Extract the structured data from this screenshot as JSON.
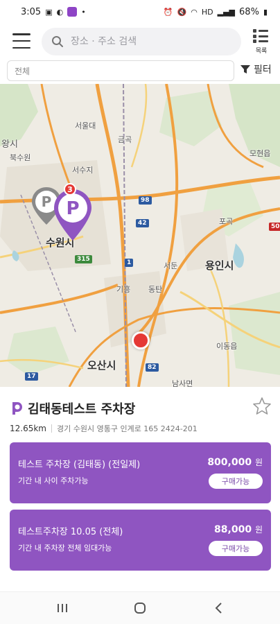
{
  "status_bar": {
    "time": "3:05",
    "battery": "68%",
    "network": "HD"
  },
  "header": {
    "search_placeholder": "장소 · 주소 검색",
    "list_label": "목록"
  },
  "filter": {
    "category_value": "전체",
    "filter_label": "필터"
  },
  "map": {
    "cluster_count": "3",
    "labels": {
      "city_suwon": "수원시",
      "city_yongin": "용인시",
      "city_osan": "오산시",
      "wangsi": "왕시",
      "area_1": "북수원",
      "area_2": "서울대",
      "area_3": "금곡",
      "area_4": "서수지",
      "area_5": "포곡",
      "area_6": "이동읍",
      "area_7": "남사면",
      "area_8": "동탄",
      "area_9": "모현읍",
      "area_10": "서둔",
      "area_11": "기흥"
    },
    "shields": {
      "s1": "42",
      "s2": "1",
      "s3": "98",
      "s4": "17",
      "s5": "82",
      "s6": "315",
      "s7": "50"
    }
  },
  "parking_lot": {
    "name": "김태동테스트 주차장",
    "distance": "12.65km",
    "address": "경기 수원시 영통구 인계로 165 2424-201",
    "tickets": [
      {
        "name": "테스트 주차장 (김태동) (전일제)",
        "description": "기간 내 사이 주차가능",
        "price": "800,000",
        "currency": "원",
        "buy_label": "구매가능"
      },
      {
        "name": "테스트주차장 10.05 (전체)",
        "description": "기간 내 주차장 전체 임대가능",
        "price": "88,000",
        "currency": "원",
        "buy_label": "구매가능"
      }
    ]
  },
  "colors": {
    "brand_purple": "#8f55c1",
    "location_red": "#e53935"
  }
}
